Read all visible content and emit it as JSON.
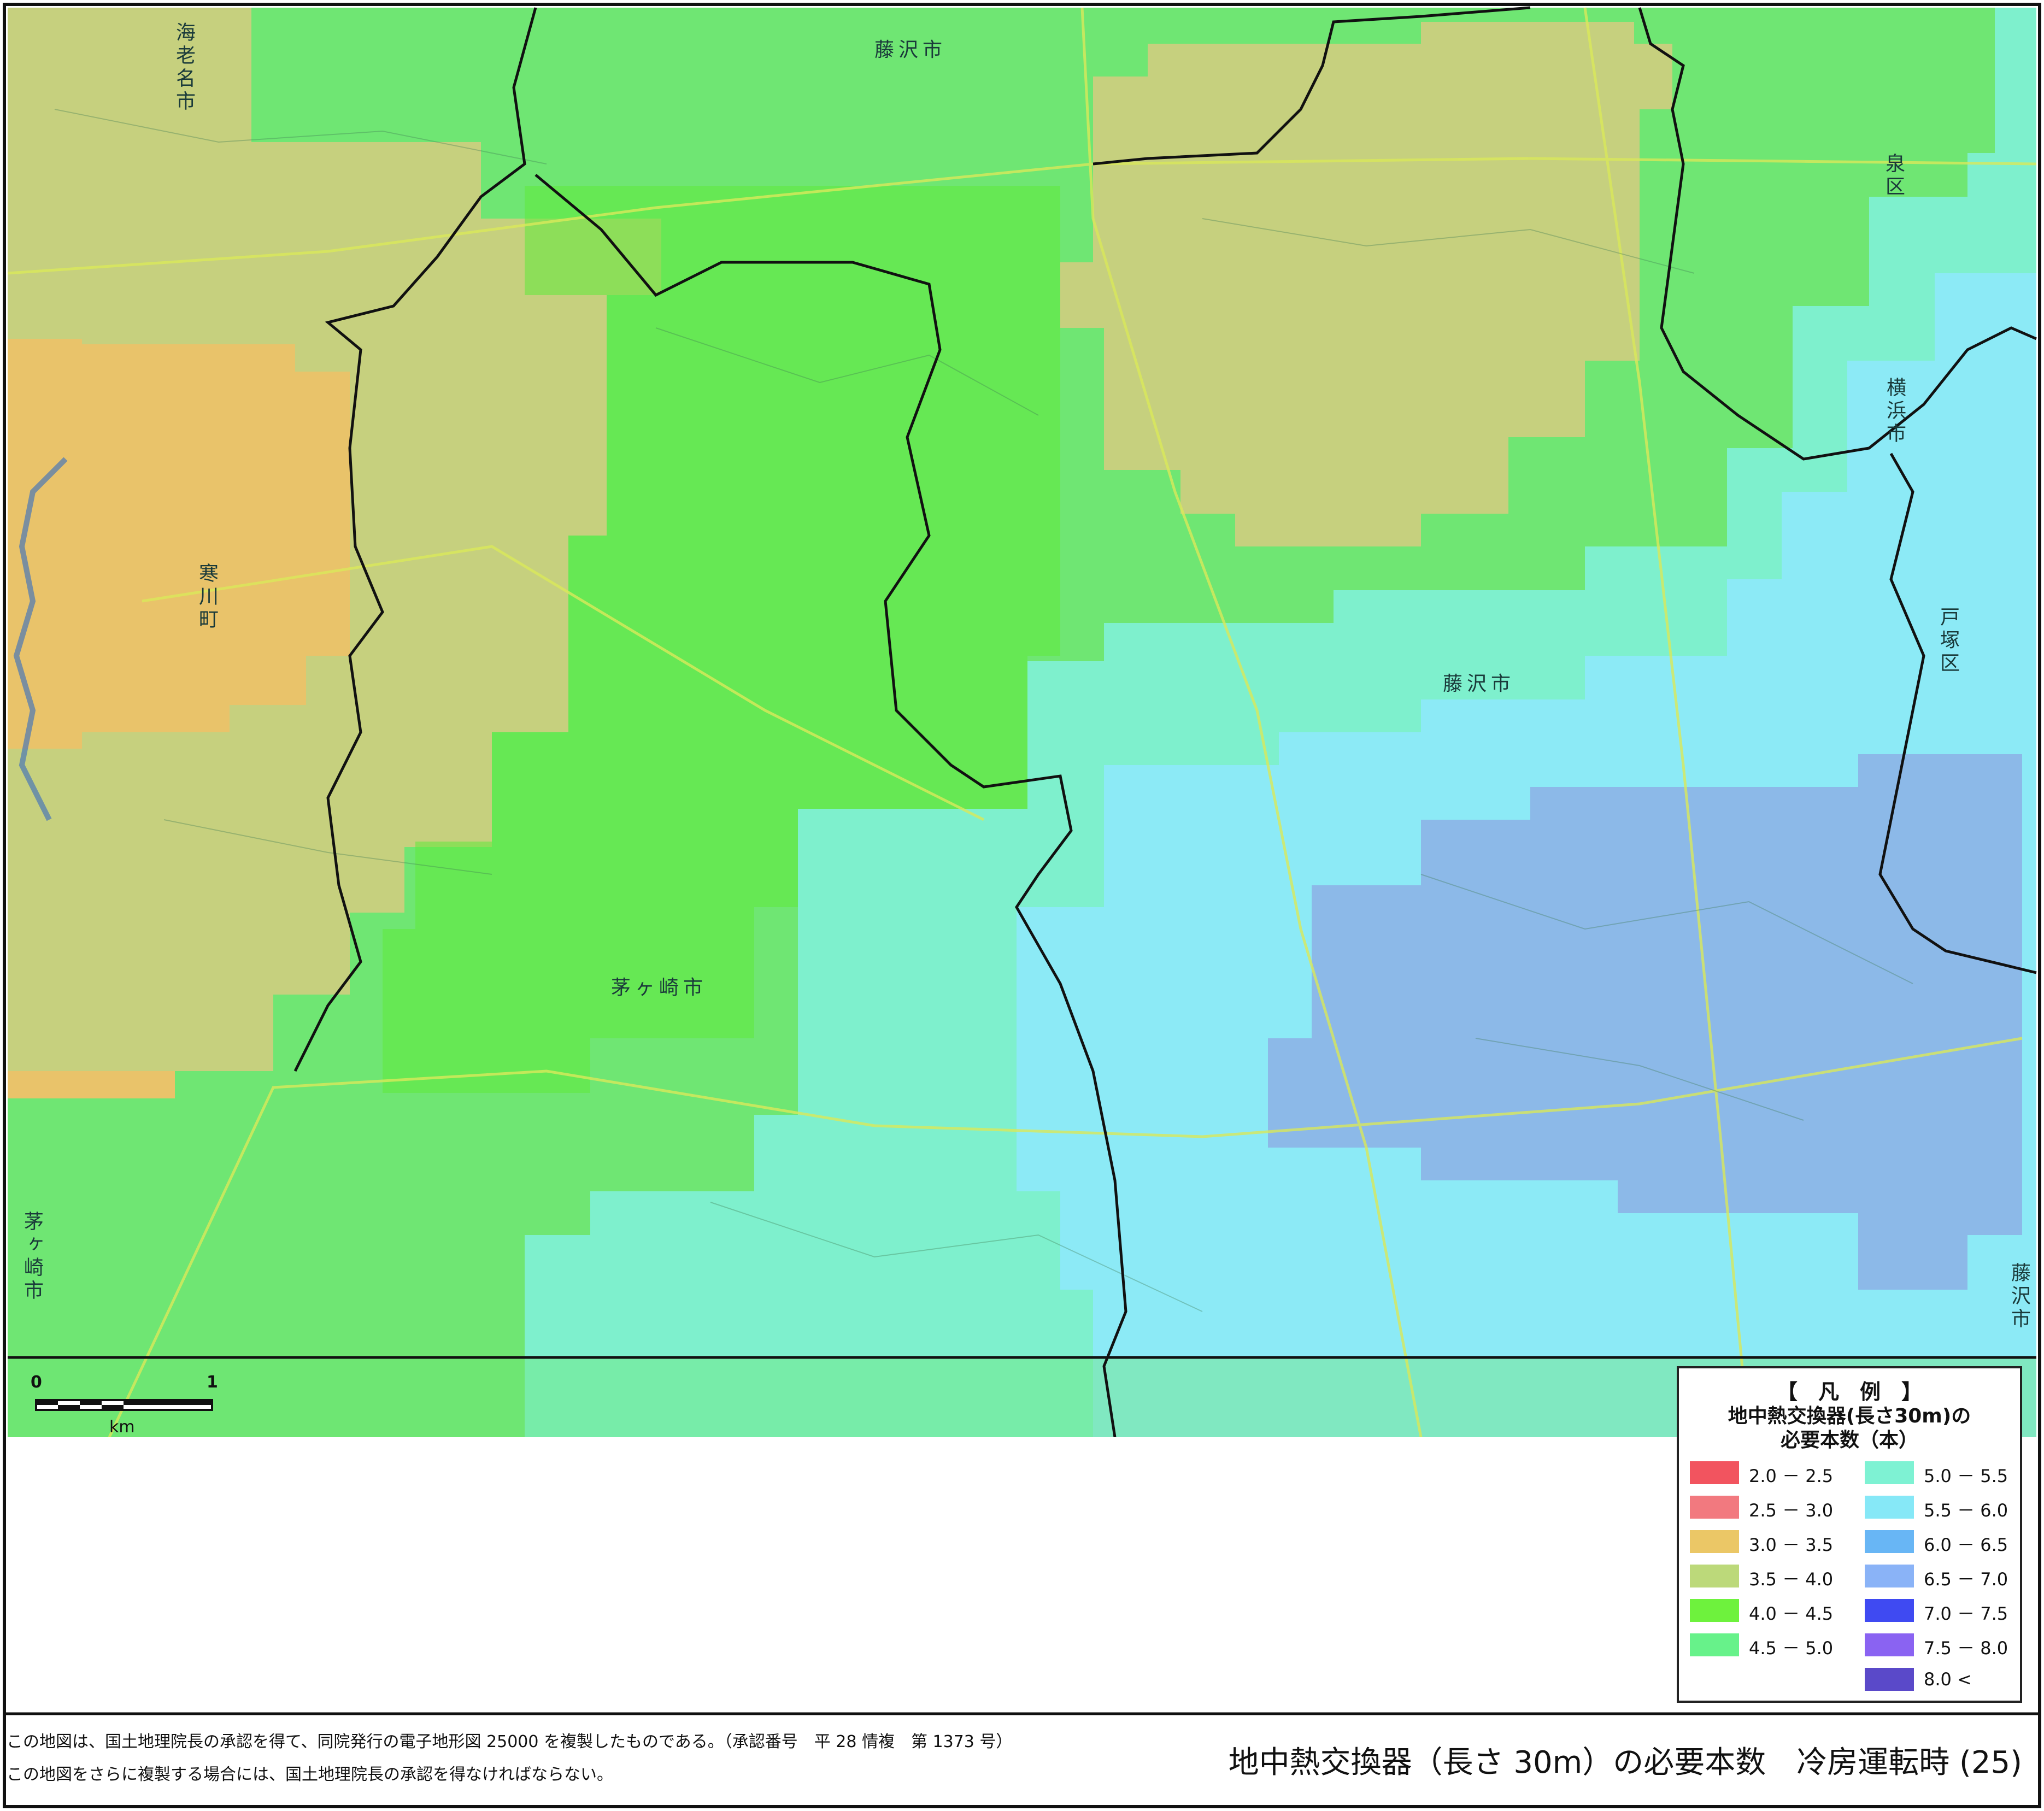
{
  "map": {
    "place_labels": [
      {
        "id": "ebina",
        "text": "海老名市"
      },
      {
        "id": "fujisawa-top",
        "text": "藤沢市"
      },
      {
        "id": "izumi",
        "text": "泉区"
      },
      {
        "id": "yokohama",
        "text": "横浜市"
      },
      {
        "id": "samukawa",
        "text": "寒川町"
      },
      {
        "id": "totsuka",
        "text": "戸塚区"
      },
      {
        "id": "fujisawa-mid",
        "text": "藤沢市"
      },
      {
        "id": "chigasaki",
        "text": "茅ヶ崎市"
      },
      {
        "id": "chigasaki-left",
        "text": "茅ヶ崎市"
      },
      {
        "id": "fujisawa-right",
        "text": "藤沢市"
      }
    ],
    "scale_bar": {
      "start": "0",
      "end": "1",
      "unit": "km"
    }
  },
  "legend": {
    "bracket_title": "【　凡　例　】",
    "subtitle_1": "地中熱交換器(長さ30m)の",
    "subtitle_2": "必要本数（本）",
    "items": [
      {
        "label": "2.0 － 2.5",
        "color": "#f2545f"
      },
      {
        "label": "2.5 － 3.0",
        "color": "#f2797f"
      },
      {
        "label": "3.0 － 3.5",
        "color": "#ebc766"
      },
      {
        "label": "3.5 － 4.0",
        "color": "#bcd97a"
      },
      {
        "label": "4.0 － 4.5",
        "color": "#6ef23d"
      },
      {
        "label": "4.5 － 5.0",
        "color": "#67f28a"
      },
      {
        "label": "5.0 － 5.5",
        "color": "#7ef2d3"
      },
      {
        "label": "5.5 － 6.0",
        "color": "#86e8f7"
      },
      {
        "label": "6.0 － 6.5",
        "color": "#68b6f5"
      },
      {
        "label": "6.5 － 7.0",
        "color": "#8ab3f7"
      },
      {
        "label": "7.0 － 7.5",
        "color": "#3f4af2"
      },
      {
        "label": "7.5 － 8.0",
        "color": "#8a63f2"
      },
      {
        "label": "8.0 <",
        "color": "#5a49c9"
      }
    ]
  },
  "footer": {
    "note_1": "この地図は、国土地理院長の承認を得て、同院発行の電子地形図 25000 を複製したものである。（承認番号　平 28 情複　第 1373 号）",
    "note_2": "この地図をさらに複製する場合には、国土地理院長の承認を得なければならない。",
    "title": "地中熱交換器（長さ 30m）の必要本数　冷房運転時 (25)"
  }
}
